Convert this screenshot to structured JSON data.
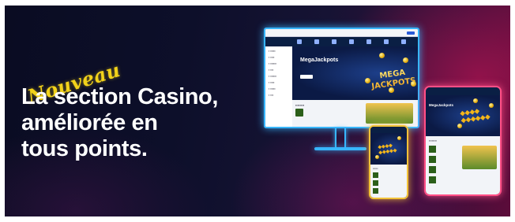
{
  "badge": {
    "text": "Nouveau"
  },
  "headline": {
    "line1": "La section Casino,",
    "line2": "améliorée en",
    "line3": "tous points."
  },
  "devices": {
    "monitor_hero_title": "MegaJackpots",
    "monitor_logo_line1": "MEGA",
    "monitor_logo_line2": "JACKPOTS",
    "tablet_hero_title": "MegaJackpots"
  },
  "colors": {
    "headline": "#ffffff",
    "badge": "#f2d21a",
    "monitor_glow": "#38b6ff",
    "phone_glow": "#f2c238",
    "tablet_glow": "#ff4f86"
  }
}
